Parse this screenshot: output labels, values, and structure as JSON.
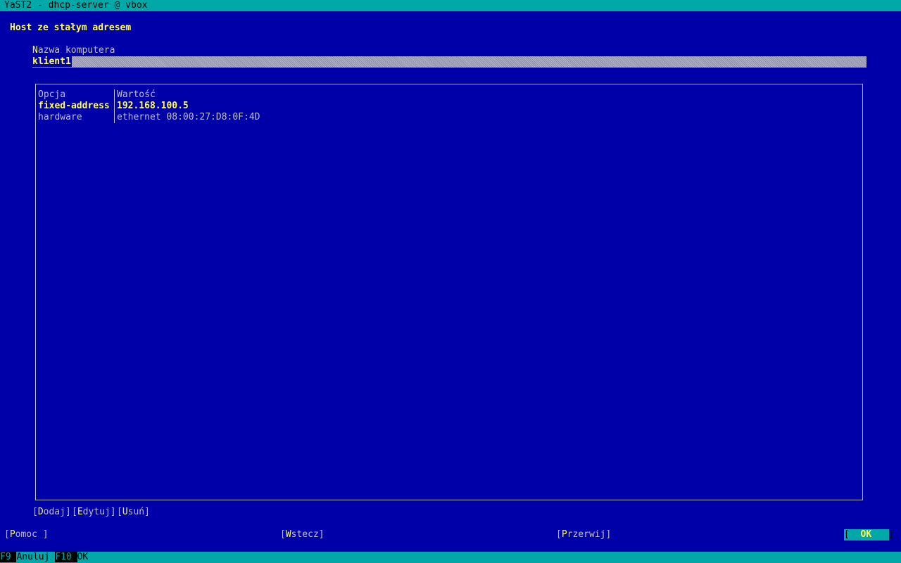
{
  "window": {
    "title": "YaST2 - dhcp-server @ vbox"
  },
  "dialog": {
    "heading": "Host ze stałym adresem",
    "hostname": {
      "label_hot": "N",
      "label_rest": "azwa komputera",
      "value": "klient1"
    }
  },
  "table": {
    "headers": [
      "Opcja",
      "Wartość"
    ],
    "rows": [
      {
        "option": "fixed-address",
        "value": "192.168.100.5",
        "selected": true
      },
      {
        "option": "hardware",
        "value": "ethernet 08:00:27:D8:0F:4D",
        "selected": false
      }
    ]
  },
  "table_buttons": {
    "add": {
      "hot": "D",
      "rest": "odaj"
    },
    "edit": {
      "hot": "E",
      "rest": "dytuj"
    },
    "remove": {
      "hot": "U",
      "rest": "suń"
    }
  },
  "nav_buttons": {
    "help": {
      "hot": "P",
      "rest": "omoc "
    },
    "back": {
      "hot": "W",
      "rest": "stecz"
    },
    "abort": {
      "hot": "P",
      "rest": "rzerwij"
    },
    "ok": {
      "hot": "O",
      "rest": "K"
    }
  },
  "function_keys": [
    {
      "key": "F9",
      "action": "Anuluj"
    },
    {
      "key": "F10",
      "action": "OK"
    }
  ],
  "colors": {
    "background": "#0000a8",
    "accent": "#00a8a8",
    "highlight": "#ffff54"
  }
}
